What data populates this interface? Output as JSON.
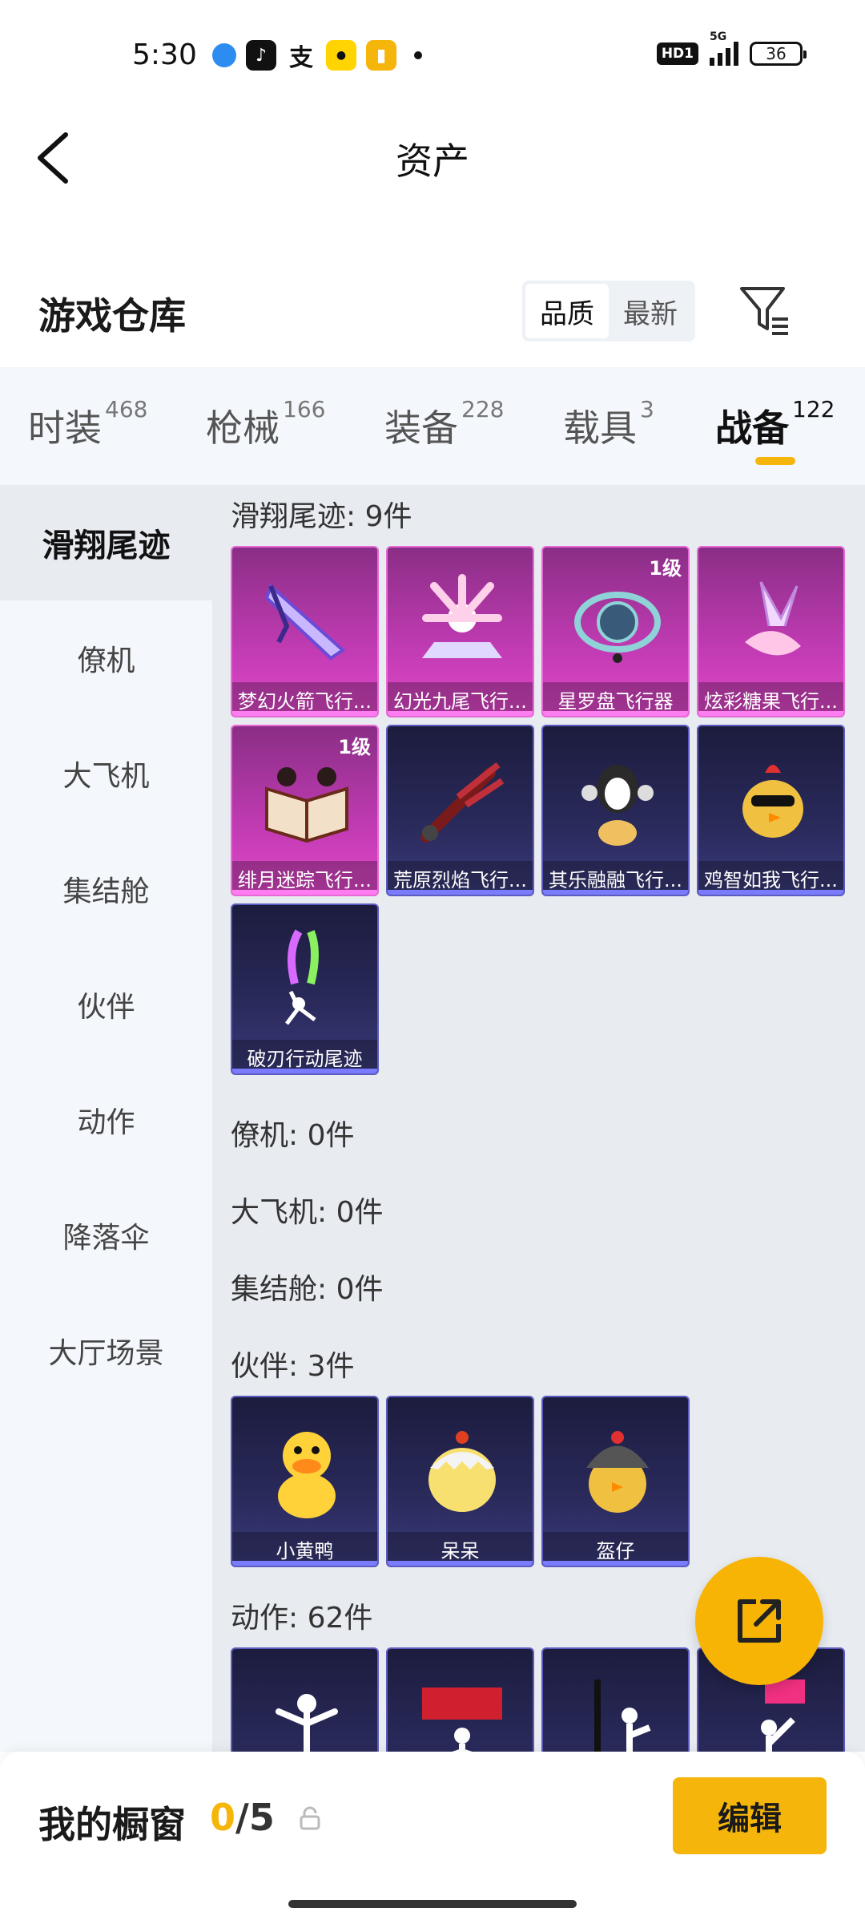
{
  "status": {
    "time": "5:30",
    "hd": "HD1",
    "net": "5G",
    "battery": "36"
  },
  "header": {
    "title": "资产"
  },
  "warehouse": {
    "title": "游戏仓库",
    "sort_quality": "品质",
    "sort_latest": "最新"
  },
  "tabs": [
    {
      "label": "时装",
      "count": "468"
    },
    {
      "label": "枪械",
      "count": "166"
    },
    {
      "label": "装备",
      "count": "228"
    },
    {
      "label": "载具",
      "count": "3"
    },
    {
      "label": "战备",
      "count": "122"
    }
  ],
  "sidebar": [
    "滑翔尾迹",
    "僚机",
    "大飞机",
    "集结舱",
    "伙伴",
    "动作",
    "降落伞",
    "大厅场景"
  ],
  "sections": {
    "trail": {
      "title": "滑翔尾迹: 9件",
      "items": [
        {
          "name": "梦幻火箭飞行...",
          "level": ""
        },
        {
          "name": "幻光九尾飞行...",
          "level": ""
        },
        {
          "name": "星罗盘飞行器",
          "level": "1级"
        },
        {
          "name": "炫彩糖果飞行...",
          "level": ""
        },
        {
          "name": "绯月迷踪飞行...",
          "level": "1级"
        },
        {
          "name": "荒原烈焰飞行...",
          "level": ""
        },
        {
          "name": "其乐融融飞行...",
          "level": ""
        },
        {
          "name": "鸡智如我飞行...",
          "level": ""
        },
        {
          "name": "破刃行动尾迹",
          "level": ""
        }
      ]
    },
    "wingman": {
      "title": "僚机: 0件"
    },
    "plane": {
      "title": "大飞机: 0件"
    },
    "pod": {
      "title": "集结舱: 0件"
    },
    "partner": {
      "title": "伙伴: 3件",
      "items": [
        {
          "name": "小黄鸭"
        },
        {
          "name": "呆呆"
        },
        {
          "name": "盔仔"
        }
      ]
    },
    "action": {
      "title": "动作: 62件"
    }
  },
  "showcase": {
    "label": "我的橱窗",
    "current": "0",
    "total": "/5",
    "edit": "编辑"
  }
}
